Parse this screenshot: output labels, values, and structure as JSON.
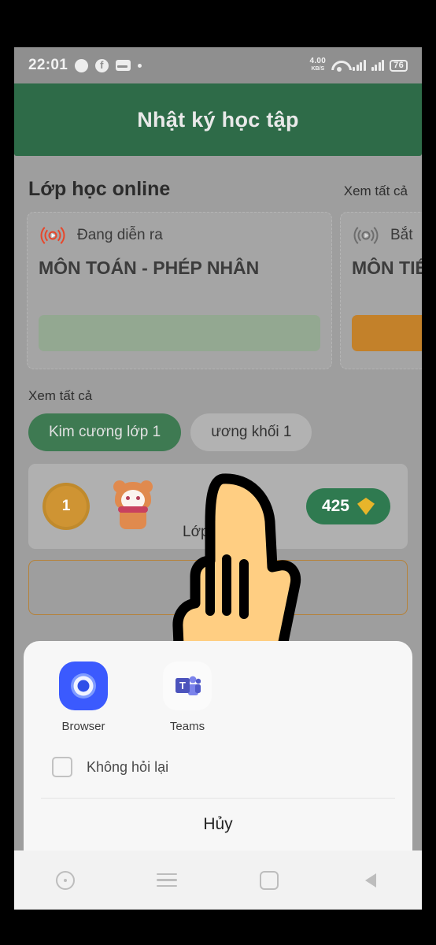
{
  "status_bar": {
    "time": "22:01",
    "icons_left": [
      "messenger-icon",
      "facebook-icon",
      "card-icon",
      "dot-icon"
    ],
    "network_speed": "4.00",
    "network_speed_unit": "KB/S",
    "icons_right": [
      "wifi-icon",
      "signal-1-icon",
      "signal-2-icon"
    ],
    "battery": "76"
  },
  "app_bar": {
    "title": "Nhật ký học tập",
    "color": "#2e6b48"
  },
  "online_class_section": {
    "title": "Lớp học online",
    "see_all": "Xem tất cả",
    "cards": [
      {
        "status": "Đang diễn ra",
        "status_icon": "live-broadcast-icon",
        "title": "MÔN TOÁN - PHÉP NHÂN",
        "button_label": "",
        "button_color": "#93a891"
      },
      {
        "status": "Bắt",
        "status_icon": "live-broadcast-icon",
        "title": "MÔN TIẾ VĂN",
        "button_label": "",
        "button_color": "#c3812a"
      }
    ]
  },
  "ranking_section": {
    "see_all": "Xem tất cả",
    "tabs": [
      {
        "label": "Kim cương lớp 1",
        "active": true
      },
      {
        "label": "ương khối 1",
        "active": false
      }
    ],
    "rank_badge": "1",
    "mascot_icon": "cat-mascot-icon",
    "class_label": "Lớp",
    "gem_count": "425",
    "gem_icon": "diamond-icon",
    "gem_pill_color": "#2f7a50"
  },
  "bottom_sheet": {
    "apps": [
      {
        "label": "Browser",
        "icon": "browser-icon"
      },
      {
        "label": "Teams",
        "icon": "teams-icon"
      }
    ],
    "checkbox_label": "Không hỏi lại",
    "checkbox_checked": false,
    "cancel_label": "Hủy"
  },
  "nav_bar": {
    "buttons": [
      "assistant-circle-icon",
      "menu-icon",
      "home-square-icon",
      "back-triangle-icon"
    ]
  },
  "overlay": {
    "pointer_icon": "pointing-hand-icon"
  }
}
